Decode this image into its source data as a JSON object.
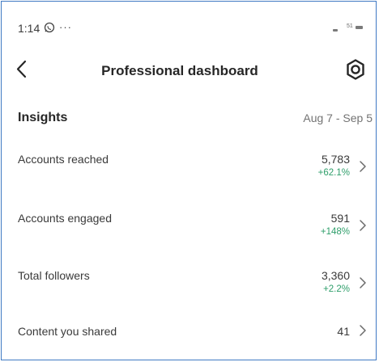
{
  "status_bar": {
    "time": "1:14",
    "more": "···",
    "battery": "51"
  },
  "header": {
    "title": "Professional dashboard",
    "back_icon": "chevron-left-icon",
    "settings_icon": "gear-icon"
  },
  "insights": {
    "title": "Insights",
    "date_range": "Aug 7 - Sep 5",
    "metrics": [
      {
        "label": "Accounts reached",
        "value": "5,783",
        "change": "+62.1%"
      },
      {
        "label": "Accounts engaged",
        "value": "591",
        "change": "+148%"
      },
      {
        "label": "Total followers",
        "value": "3,360",
        "change": "+2.2%"
      },
      {
        "label": "Content you shared",
        "value": "41",
        "change": ""
      }
    ]
  },
  "colors": {
    "positive_change": "#2e9e6a",
    "frame_border": "#3f79c3",
    "primary_text": "#262626",
    "secondary_text": "#737373"
  }
}
